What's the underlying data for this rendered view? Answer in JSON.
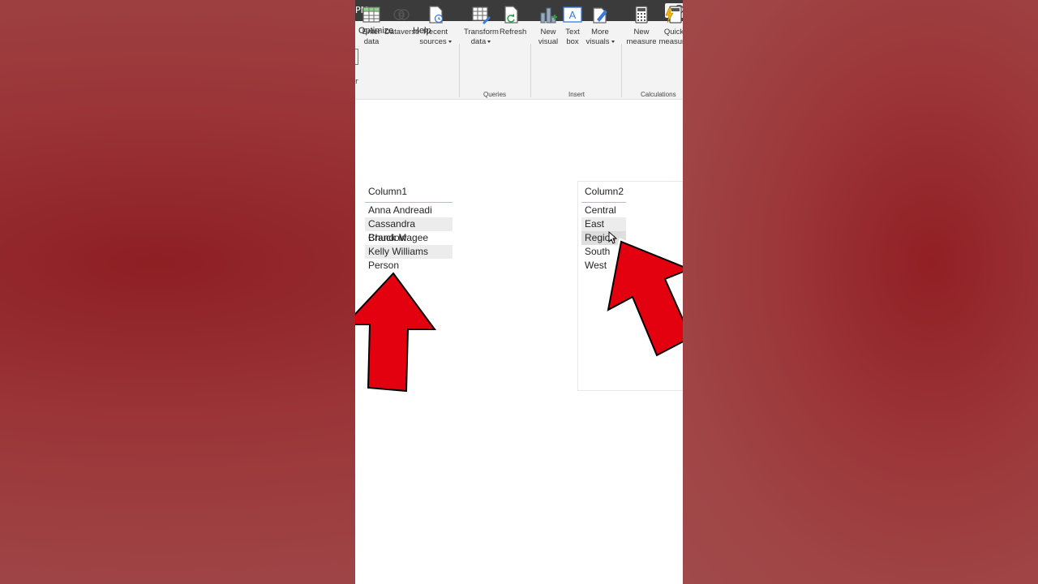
{
  "window": {
    "title_fragment": "PM"
  },
  "menu": {
    "items": [
      "Optimize",
      "Help"
    ]
  },
  "ribbon": {
    "buttons": [
      {
        "line1": "Enter",
        "line2": "data",
        "icon": "table-icon"
      },
      {
        "line1": "Dataverse",
        "line2": "",
        "icon": "dataverse-icon"
      },
      {
        "line1": "Recent",
        "line2": "sources",
        "icon": "recent-sources-icon"
      },
      {
        "line1": "Transform",
        "line2": "data",
        "icon": "transform-data-icon"
      },
      {
        "line1": "Refresh",
        "line2": "",
        "icon": "refresh-icon"
      },
      {
        "line1": "New",
        "line2": "visual",
        "icon": "new-visual-icon"
      },
      {
        "line1": "Text",
        "line2": "box",
        "icon": "text-box-icon"
      },
      {
        "line1": "More",
        "line2": "visuals",
        "icon": "more-visuals-icon"
      },
      {
        "line1": "New",
        "line2": "measure",
        "icon": "calculator-icon"
      },
      {
        "line1": "Quick",
        "line2": "measure",
        "icon": "quick-measure-icon"
      }
    ],
    "groups": [
      "Queries",
      "Insert",
      "Calculations"
    ]
  },
  "slicers": [
    {
      "header": "Column1",
      "items": [
        "Anna Andreadi",
        "Cassandra Brandow",
        "Chuck Magee",
        "Kelly Williams",
        "Person"
      ]
    },
    {
      "header": "Column2",
      "items": [
        "Central",
        "East",
        "Region",
        "South",
        "West"
      ]
    }
  ],
  "colors": {
    "accent_arrow": "#e3000f",
    "title_bar": "#3b3b3b",
    "ribbon_bg": "#f3f3f3",
    "slicer_underline": "#9fc4e0"
  }
}
